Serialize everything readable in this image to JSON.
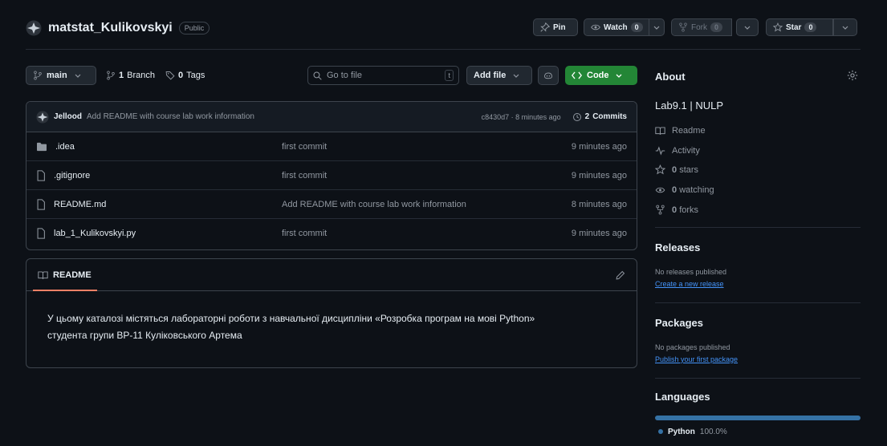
{
  "repo": {
    "name": "matstat_Kulikovskyi",
    "visibility": "Public"
  },
  "header_actions": {
    "pin": "Pin",
    "watch": "Watch",
    "watch_count": "0",
    "fork": "Fork",
    "fork_count": "0",
    "star": "Star",
    "star_count": "0"
  },
  "toolbar": {
    "branch": "main",
    "branch_count": "1",
    "branch_label": "Branch",
    "tag_count": "0",
    "tag_label": "Tags",
    "search_placeholder": "Go to file",
    "search_kbd": "t",
    "add_file": "Add file",
    "code": "Code"
  },
  "latest_commit": {
    "author": "Jellood",
    "message": "Add README with course lab work information",
    "hash_time": "c8430d7 · 8 minutes ago",
    "commits_count": "2",
    "commits_label": "Commits"
  },
  "files": [
    {
      "name": ".idea",
      "type": "folder",
      "message": "first commit",
      "time": "9 minutes ago"
    },
    {
      "name": ".gitignore",
      "type": "file",
      "message": "first commit",
      "time": "9 minutes ago"
    },
    {
      "name": "README.md",
      "type": "file",
      "message": "Add README with course lab work information",
      "time": "8 minutes ago"
    },
    {
      "name": "lab_1_Kulikovskyi.py",
      "type": "file",
      "message": "first commit",
      "time": "9 minutes ago"
    }
  ],
  "readme": {
    "tab": "README",
    "line1": "У цьому каталозі містяться лабораторні роботи з навчальної дисципліни «Розробка програм на мові Python»",
    "line2": "студента групи ВР-11 Куліковського Артема"
  },
  "about": {
    "heading": "About",
    "description": "Lab9.1 | NULP",
    "readme": "Readme",
    "activity": "Activity",
    "stars": "0",
    "stars_label": "stars",
    "watching": "0",
    "watching_label": "watching",
    "forks": "0",
    "forks_label": "forks"
  },
  "releases": {
    "heading": "Releases",
    "empty": "No releases published",
    "link": "Create a new release"
  },
  "packages": {
    "heading": "Packages",
    "empty": "No packages published",
    "link": "Publish your first package"
  },
  "languages": {
    "heading": "Languages",
    "name": "Python",
    "percent": "100.0%",
    "fraction": 1.0,
    "color": "#3572A5"
  },
  "colors": {
    "background": "#0d1117",
    "border": "#3d444d",
    "code_button": "#238636",
    "link": "#4493f8",
    "tab_underline": "#f78166"
  }
}
